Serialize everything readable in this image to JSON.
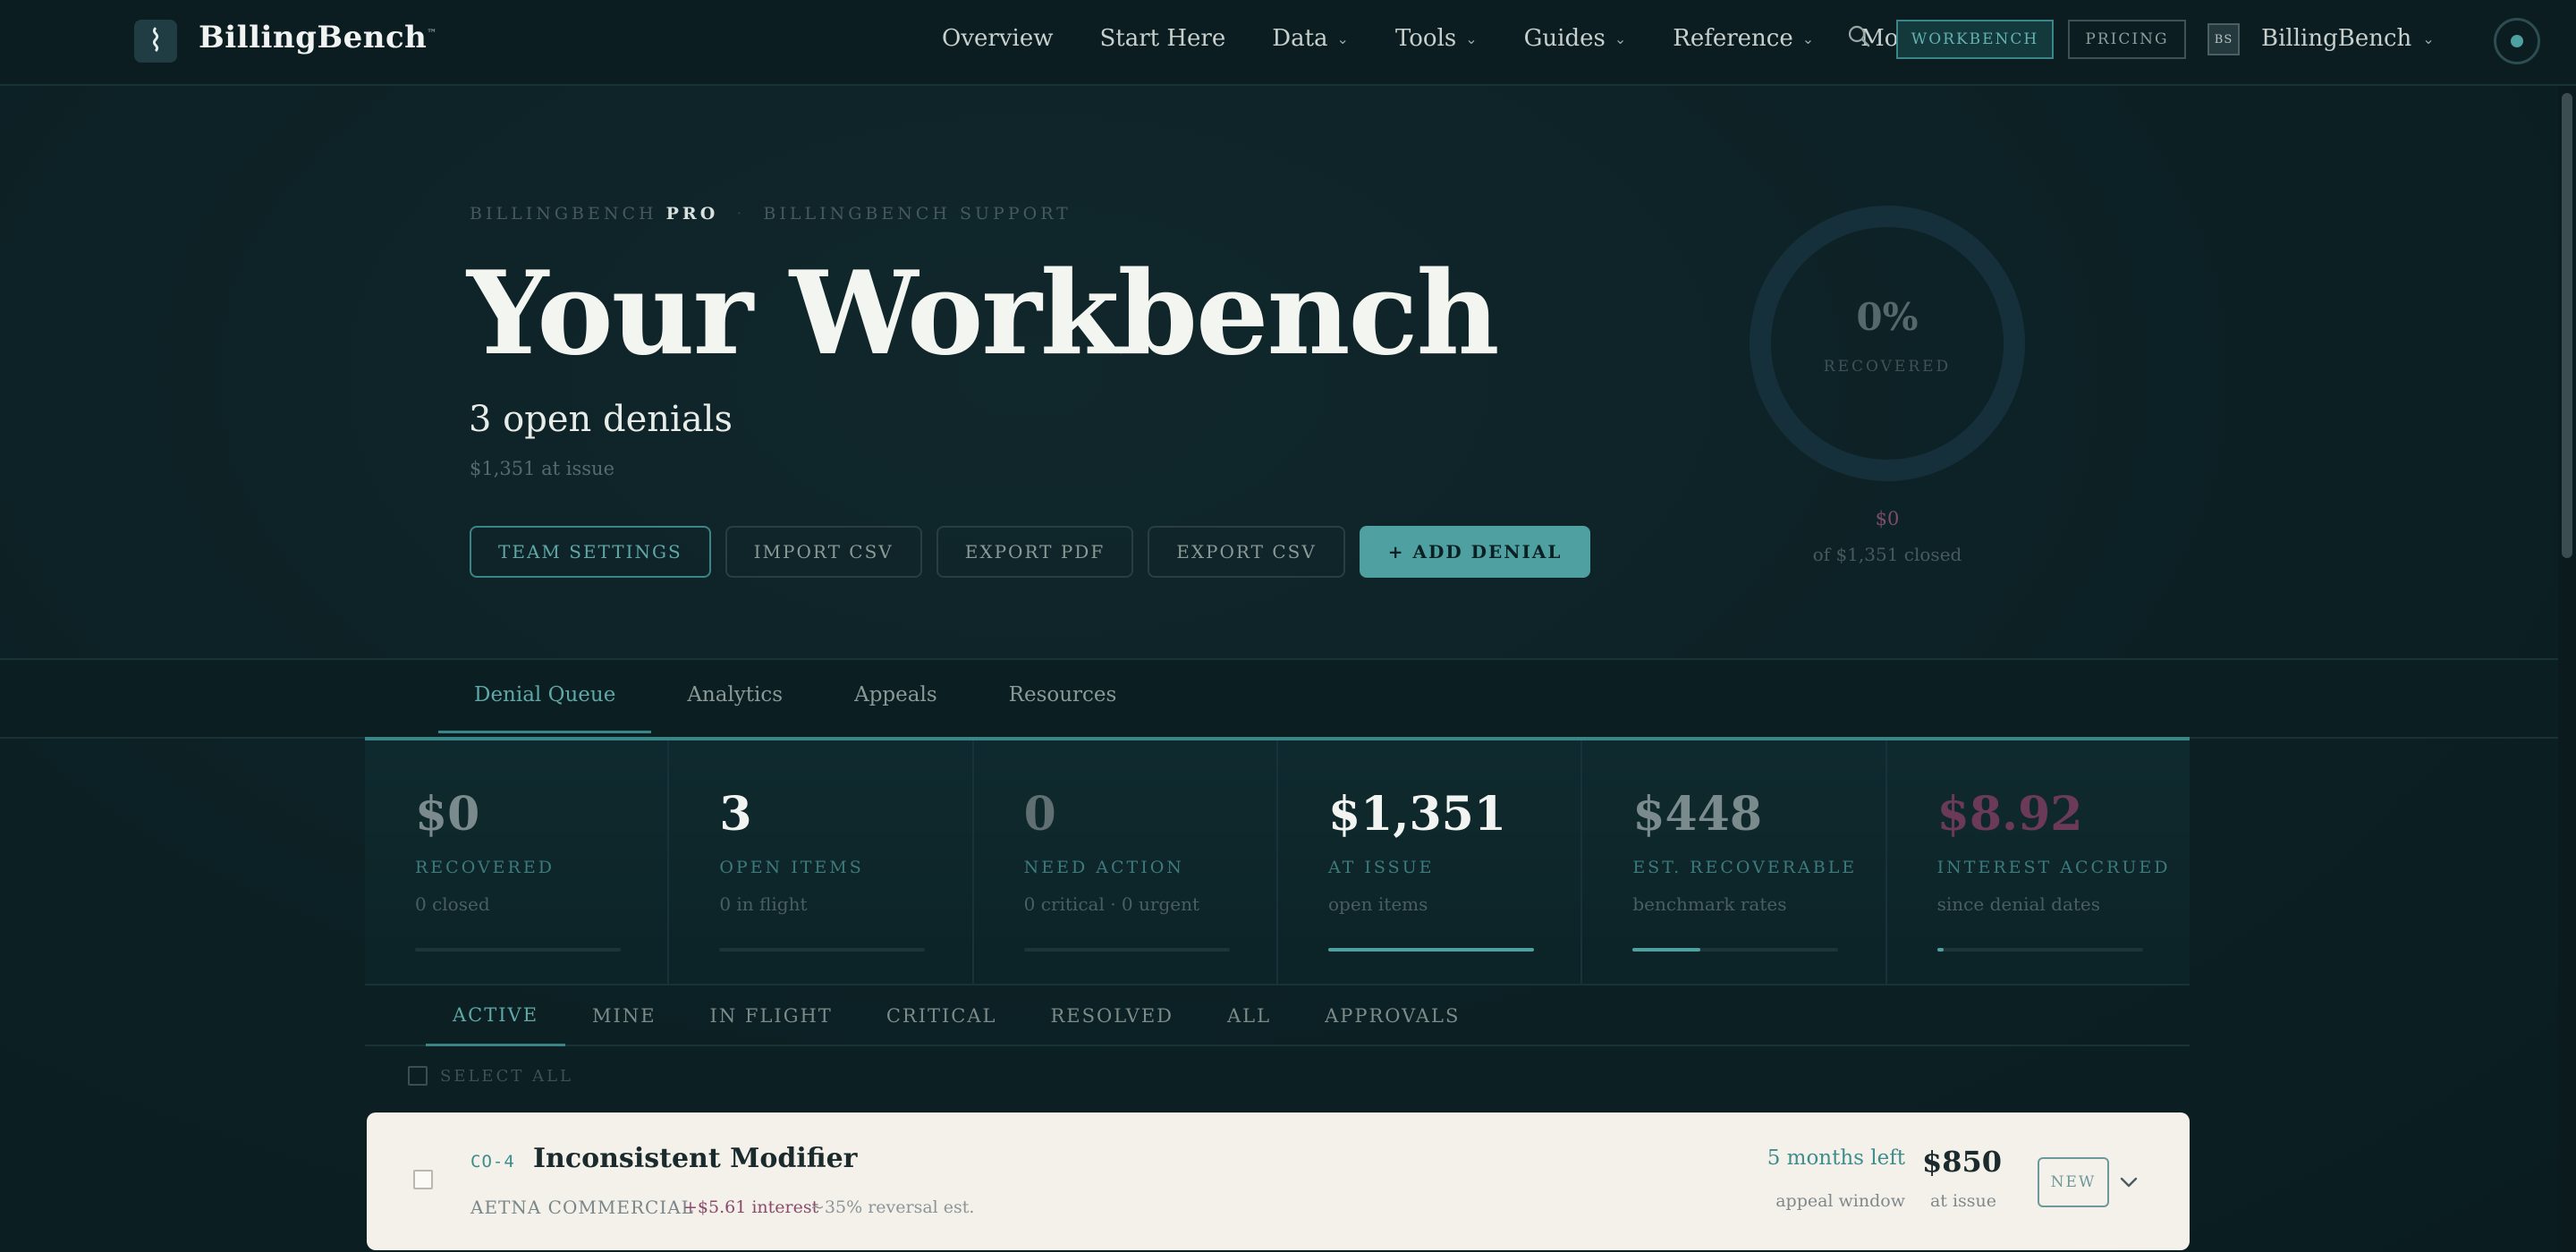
{
  "nav": {
    "brand": "BillingBench",
    "brand_tm": "™",
    "logo_glyph": "⌇",
    "links": [
      {
        "label": "Overview",
        "has_dropdown": false
      },
      {
        "label": "Start Here",
        "has_dropdown": false
      },
      {
        "label": "Data",
        "has_dropdown": true
      },
      {
        "label": "Tools",
        "has_dropdown": true
      },
      {
        "label": "Guides",
        "has_dropdown": true
      },
      {
        "label": "Reference",
        "has_dropdown": true
      },
      {
        "label": "More",
        "has_dropdown": true
      }
    ],
    "workbench_label": "WORKBENCH",
    "pricing_label": "PRICING",
    "avatar_initials": "BS",
    "user_label": "BillingBench"
  },
  "hero": {
    "breadcrumb_a": "BILLINGBENCH",
    "breadcrumb_pro": "PRO",
    "breadcrumb_sep": "·",
    "breadcrumb_b": "BILLINGBENCH SUPPORT",
    "title": "Your Workbench",
    "subtitle": "3 open denials",
    "meta": "$1,351 at issue",
    "actions": {
      "team_settings": "TEAM SETTINGS",
      "import_csv": "IMPORT CSV",
      "export_pdf": "EXPORT PDF",
      "export_csv": "EXPORT CSV",
      "add_denial": "+ ADD DENIAL"
    }
  },
  "recovery": {
    "percent_label": "0%",
    "percent": 0,
    "label": "RECOVERED",
    "value": "$0",
    "of_text": "of $1,351 closed"
  },
  "tabs": [
    "Denial Queue",
    "Analytics",
    "Appeals",
    "Resources"
  ],
  "stats": [
    {
      "value": "$0",
      "label": "RECOVERED",
      "note": "0 closed",
      "fill": 0
    },
    {
      "value": "3",
      "label": "OPEN ITEMS",
      "note": "0 in flight",
      "fill": 0
    },
    {
      "value": "0",
      "label": "NEED ACTION",
      "note": "0 critical · 0 urgent",
      "fill": 0
    },
    {
      "value": "$1,351",
      "label": "AT ISSUE",
      "note": "open items",
      "fill": 1.0
    },
    {
      "value": "$448",
      "label": "EST. RECOVERABLE",
      "note": "benchmark rates",
      "fill": 0.33
    },
    {
      "value": "$8.92",
      "label": "INTEREST ACCRUED",
      "note": "since denial dates",
      "fill": 0.03
    }
  ],
  "filters": [
    "ACTIVE",
    "MINE",
    "IN FLIGHT",
    "CRITICAL",
    "RESOLVED",
    "ALL",
    "APPROVALS"
  ],
  "select_all": "SELECT ALL",
  "denial": {
    "id": "CO-4",
    "title": "Inconsistent Modifier",
    "payer": "AETNA COMMERCIAL",
    "interest": "+$5.61 interest",
    "reversal": "~35% reversal est.",
    "deadline": "5 months left",
    "deadline_sub": "appeal window",
    "amount": "$850",
    "amount_sub": "at issue",
    "badge": "NEW"
  },
  "colors": {
    "accent": "#4fa0a0",
    "background": "#0c2024",
    "plum": "#7c4d68",
    "card": "#f4f1ea"
  }
}
